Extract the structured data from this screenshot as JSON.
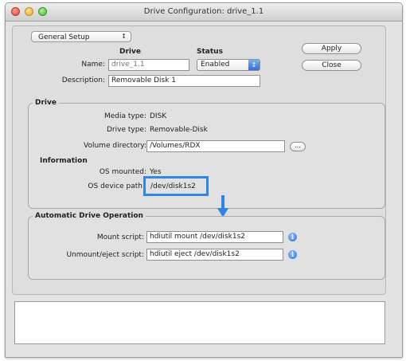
{
  "window": {
    "title": "Drive Configuration: drive_1.1",
    "traffic_lights": [
      "close",
      "minimize",
      "zoom"
    ]
  },
  "setup_popup": {
    "label": "General Setup",
    "icon": "up-down-arrows"
  },
  "buttons": {
    "apply": "Apply",
    "close": "Close"
  },
  "columns": {
    "drive": "Drive",
    "status": "Status"
  },
  "name": {
    "label": "Name:",
    "value": "drive_1.1"
  },
  "status": {
    "value": "Enabled",
    "icon": "up-down-arrows"
  },
  "description": {
    "label": "Description:",
    "value": "Removable Disk 1"
  },
  "drive_group": {
    "title": "Drive",
    "media_type_label": "Media type:",
    "media_type_value": "DISK",
    "drive_type_label": "Drive type:",
    "drive_type_value": "Removable-Disk",
    "volume_dir_label": "Volume directory:",
    "volume_dir_value": "/Volumes/RDX",
    "browse_label": "...",
    "information_header": "Information",
    "os_mounted_label": "OS mounted:",
    "os_mounted_value": "Yes",
    "os_device_path_label": "OS device path:",
    "os_device_path_value": "/dev/disk1s2"
  },
  "auto_group": {
    "title": "Automatic Drive Operation",
    "mount_label": "Mount script:",
    "mount_value": "hdiutil mount /dev/disk1s2",
    "unmount_label": "Unmount/eject script:",
    "unmount_value": "hdiutil eject /dev/disk1s2",
    "info_icon": "info-icon"
  },
  "colors": {
    "highlight": "#2f86e6",
    "info_icon": "#2e6fd4",
    "status_arrows": "#2f6fd1"
  }
}
